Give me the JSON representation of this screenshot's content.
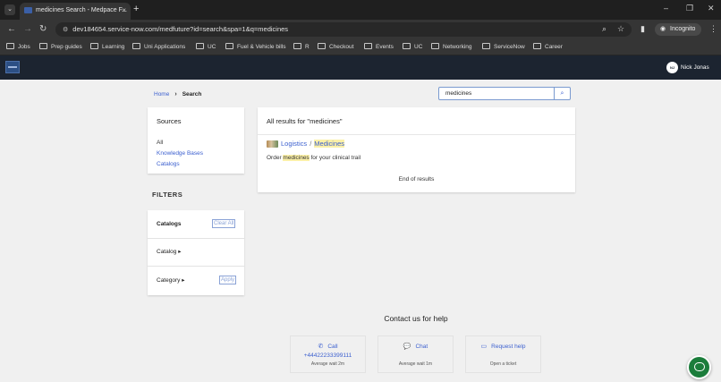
{
  "browser": {
    "tab_title": "medicines Search - Medpace F...",
    "tab_close": "×",
    "new_tab": "+",
    "tab_menu": "⌄",
    "url": "dev184654.service-now.com/medfuture?id=search&spa=1&q=medicines",
    "incognito_label": "Incognito",
    "bookmarks": [
      "Jobs",
      "Prep guides",
      "Learning",
      "Uni Applications",
      "UC",
      "Fuel & Vehicle bills",
      "R",
      "Checkout",
      "Events",
      "UC",
      "Networking",
      "ServiceNow",
      "Career"
    ]
  },
  "header": {
    "user_initials": "NJ",
    "user_name": "Nick Jonas"
  },
  "breadcrumb": {
    "home": "Home",
    "current": "Search"
  },
  "search": {
    "value": "medicines"
  },
  "sources": {
    "title": "Sources",
    "items": [
      "All",
      "Knowledge Bases",
      "Catalogs"
    ]
  },
  "filters": {
    "title": "FILTERS",
    "catalogs_label": "Catalogs",
    "clear_all": "Clear All",
    "catalog_label": "Catalog",
    "category_label": "Category",
    "apply": "Apply"
  },
  "results": {
    "heading": "All results for \"medicines\"",
    "item": {
      "path": "Logistics",
      "separator": "/",
      "title": "Medicines",
      "desc_pre": "Order ",
      "desc_highlight": "medicines",
      "desc_post": " for your clinical trail"
    },
    "end": "End of results"
  },
  "contact": {
    "title": "Contact us for help",
    "call_label": "Call",
    "call_number": "+44422233399111",
    "call_wait": "Average wait 2m",
    "chat_label": "Chat",
    "chat_wait": "Average wait 1m",
    "request_label": "Request help",
    "request_sub": "Open a ticket"
  }
}
